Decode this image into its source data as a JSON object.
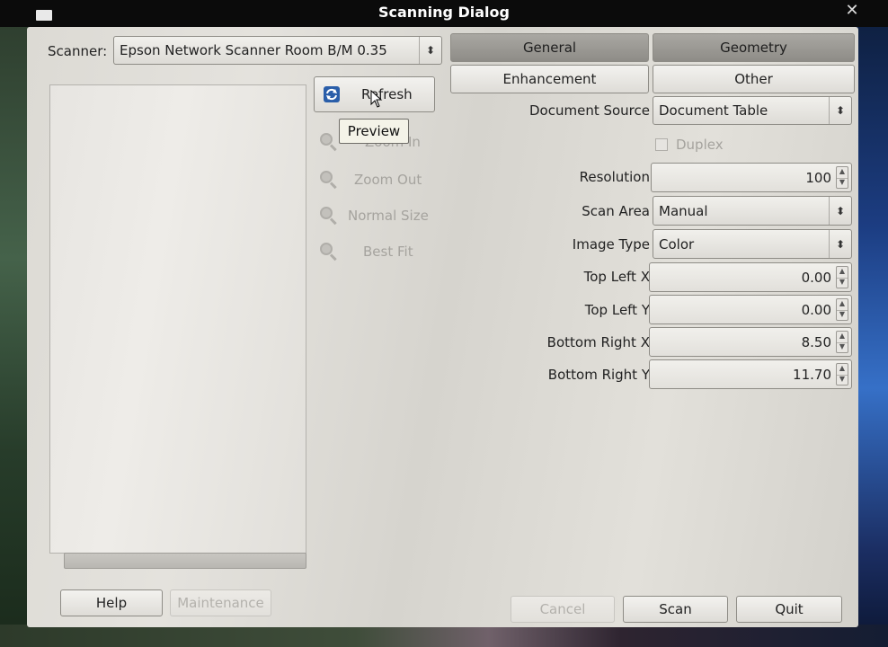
{
  "window": {
    "title": "Scanning Dialog"
  },
  "scanner": {
    "label": "Scanner:",
    "value": "Epson Network Scanner Room B/M 0.35"
  },
  "preview_tools": {
    "refresh": "Refresh",
    "zoom_in": "Zoom In",
    "zoom_out": "Zoom Out",
    "normal_size": "Normal Size",
    "best_fit": "Best Fit",
    "tooltip": "Preview"
  },
  "tabs": [
    {
      "label": "General",
      "active": true
    },
    {
      "label": "Geometry",
      "active": true
    },
    {
      "label": "Enhancement",
      "active": false
    },
    {
      "label": "Other",
      "active": false
    }
  ],
  "settings": {
    "document_source": {
      "label": "Document Source",
      "value": "Document Table"
    },
    "duplex": {
      "label": "Duplex",
      "checked": false
    },
    "resolution": {
      "label": "Resolution",
      "value": "100"
    },
    "scan_area": {
      "label": "Scan Area",
      "value": "Manual"
    },
    "image_type": {
      "label": "Image Type",
      "value": "Color"
    },
    "top_left_x": {
      "label": "Top Left X",
      "value": "0.00"
    },
    "top_left_y": {
      "label": "Top Left Y",
      "value": "0.00"
    },
    "bottom_right_x": {
      "label": "Bottom Right X",
      "value": "8.50"
    },
    "bottom_right_y": {
      "label": "Bottom Right Y",
      "value": "11.70"
    }
  },
  "buttons": {
    "help": "Help",
    "maintenance": "Maintenance",
    "cancel": "Cancel",
    "scan": "Scan",
    "quit": "Quit"
  },
  "colors": {
    "titlebar": "#0b0b0b",
    "dialog_bg": "#dcdad4",
    "active_tab": "#9a9893"
  }
}
